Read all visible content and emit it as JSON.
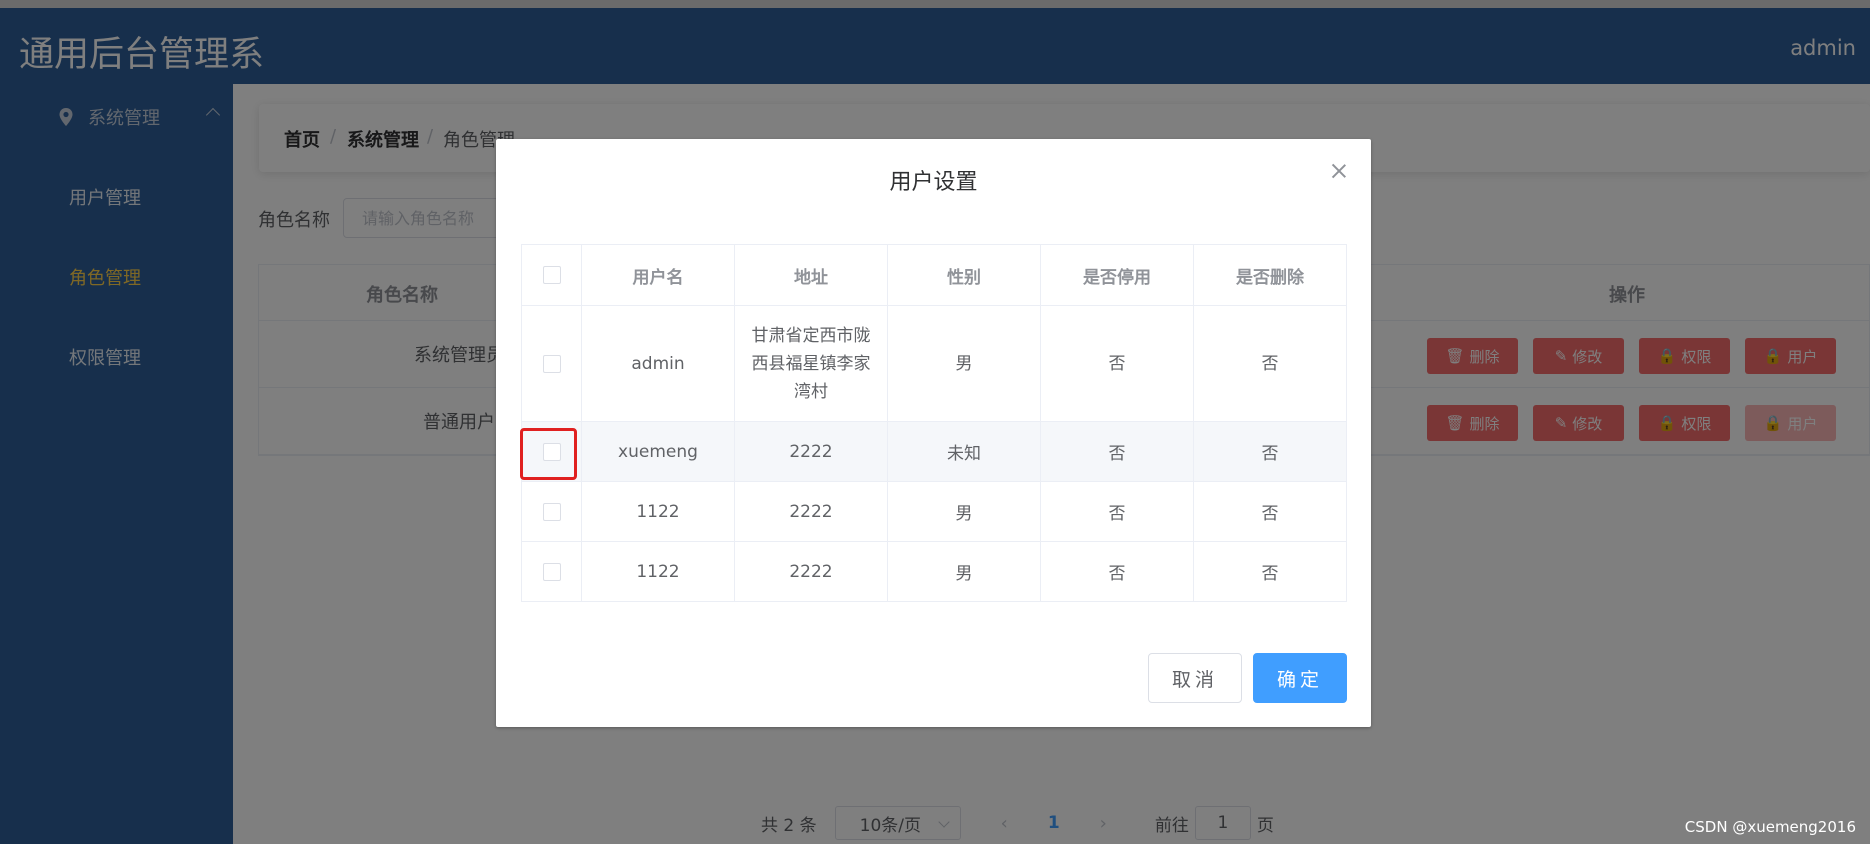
{
  "header": {
    "brand": "通用后台管理系",
    "user": "admin"
  },
  "sidebar": {
    "group_label": "系统管理",
    "items": [
      {
        "label": "用户管理",
        "active": false
      },
      {
        "label": "角色管理",
        "active": true
      },
      {
        "label": "权限管理",
        "active": false
      }
    ]
  },
  "breadcrumb": {
    "home": "首页",
    "section": "系统管理",
    "current": "角色管理",
    "separator": "/"
  },
  "filter": {
    "label": "角色名称",
    "placeholder": "请输入角色名称"
  },
  "roles_table": {
    "headers": {
      "name": "角色名称",
      "actions": "操作"
    },
    "rows": [
      {
        "name": "系统管理员"
      },
      {
        "name": "普通用户"
      }
    ],
    "actions": {
      "delete": "删除",
      "edit": "修改",
      "permission": "权限",
      "user": "用户"
    }
  },
  "pagination": {
    "total": "共 2 条",
    "page_size": "10条/页",
    "current_page": "1",
    "goto": "前往",
    "goto_value": "1",
    "page_suffix": "页"
  },
  "dialog": {
    "title": "用户设置",
    "columns": [
      "用户名",
      "地址",
      "性别",
      "是否停用",
      "是否删除"
    ],
    "rows": [
      {
        "username": "admin",
        "address": "甘肃省定西市陇西县福星镇李家湾村",
        "gender": "男",
        "disabled": "否",
        "deleted": "否"
      },
      {
        "username": "xuemeng",
        "address": "2222",
        "gender": "未知",
        "disabled": "否",
        "deleted": "否"
      },
      {
        "username": "1122",
        "address": "2222",
        "gender": "男",
        "disabled": "否",
        "deleted": "否"
      },
      {
        "username": "1122",
        "address": "2222",
        "gender": "男",
        "disabled": "否",
        "deleted": "否"
      }
    ],
    "cancel_label": "取消",
    "confirm_label": "确定"
  },
  "watermark": "CSDN @xuemeng2016",
  "colors": {
    "sidebar": "#2f5f99",
    "accent_active": "#ffd04b",
    "danger": "#f56c6c",
    "primary": "#409eff",
    "highlight_box": "#e02020"
  }
}
